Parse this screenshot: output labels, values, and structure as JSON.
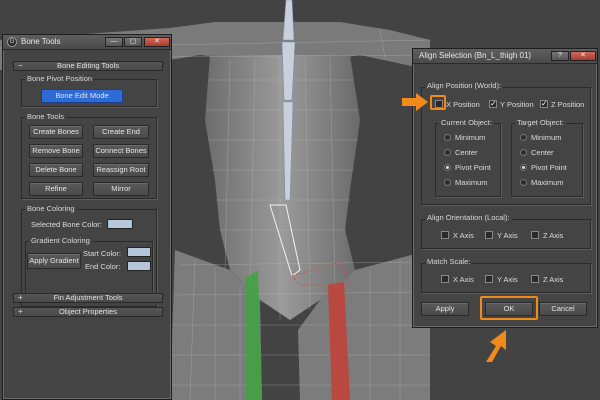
{
  "bone_tools": {
    "title": "Bone Tools",
    "window_buttons": {
      "minimize": "—",
      "restore": "▢",
      "close": "✕"
    },
    "editing_rollout": {
      "sign": "−",
      "label": "Bone Editing Tools"
    },
    "pivot_group": {
      "label": "Bone Pivot Position",
      "edit_mode_button": "Bone Edit Mode"
    },
    "tools_group": {
      "label": "Bone Tools",
      "buttons": [
        "Create Bones",
        "Create End",
        "Remove Bone",
        "Connect Bones",
        "Delete Bone",
        "Reassign Root",
        "Refine",
        "Mirror"
      ]
    },
    "coloring_group": {
      "label": "Bone Coloring",
      "selected_color_label": "Selected Bone Color:",
      "gradient_label": "Gradient Coloring",
      "apply_gradient": "Apply Gradient",
      "start_color_label": "Start Color:",
      "end_color_label": "End Color:"
    },
    "fin_rollout": {
      "sign": "+",
      "label": "Fin Adjustment Tools"
    },
    "object_rollout": {
      "sign": "+",
      "label": "Object Properties"
    }
  },
  "align": {
    "title": "Align Selection (Bn_L_thigh 01)",
    "window_buttons": {
      "help": "?",
      "close": "✕"
    },
    "position_group": {
      "label": "Align Position (World):",
      "x": {
        "label": "X Position",
        "checked": false
      },
      "y": {
        "label": "Y Position",
        "checked": true
      },
      "z": {
        "label": "Z Position",
        "checked": true
      }
    },
    "current_object": {
      "label": "Current Object:",
      "options": [
        "Minimum",
        "Center",
        "Pivot Point",
        "Maximum"
      ],
      "selected": "Pivot Point"
    },
    "target_object": {
      "label": "Target Object:",
      "options": [
        "Minimum",
        "Center",
        "Pivot Point",
        "Maximum"
      ],
      "selected": "Pivot Point"
    },
    "orientation_group": {
      "label": "Align Orientation (Local):",
      "x": "X Axis",
      "y": "Y Axis",
      "z": "Z Axis"
    },
    "scale_group": {
      "label": "Match Scale:",
      "x": "X Axis",
      "y": "Y Axis",
      "z": "Z Axis"
    },
    "apply": "Apply",
    "ok": "OK",
    "cancel": "Cancel"
  },
  "colors": {
    "highlight": "#f08a1c",
    "edit_mode_button": "#2f6bd6",
    "swatch": "#b5c6db",
    "viewport_bg": "#434343",
    "bone_green": "#3fa33f",
    "bone_red": "#c0433a"
  }
}
